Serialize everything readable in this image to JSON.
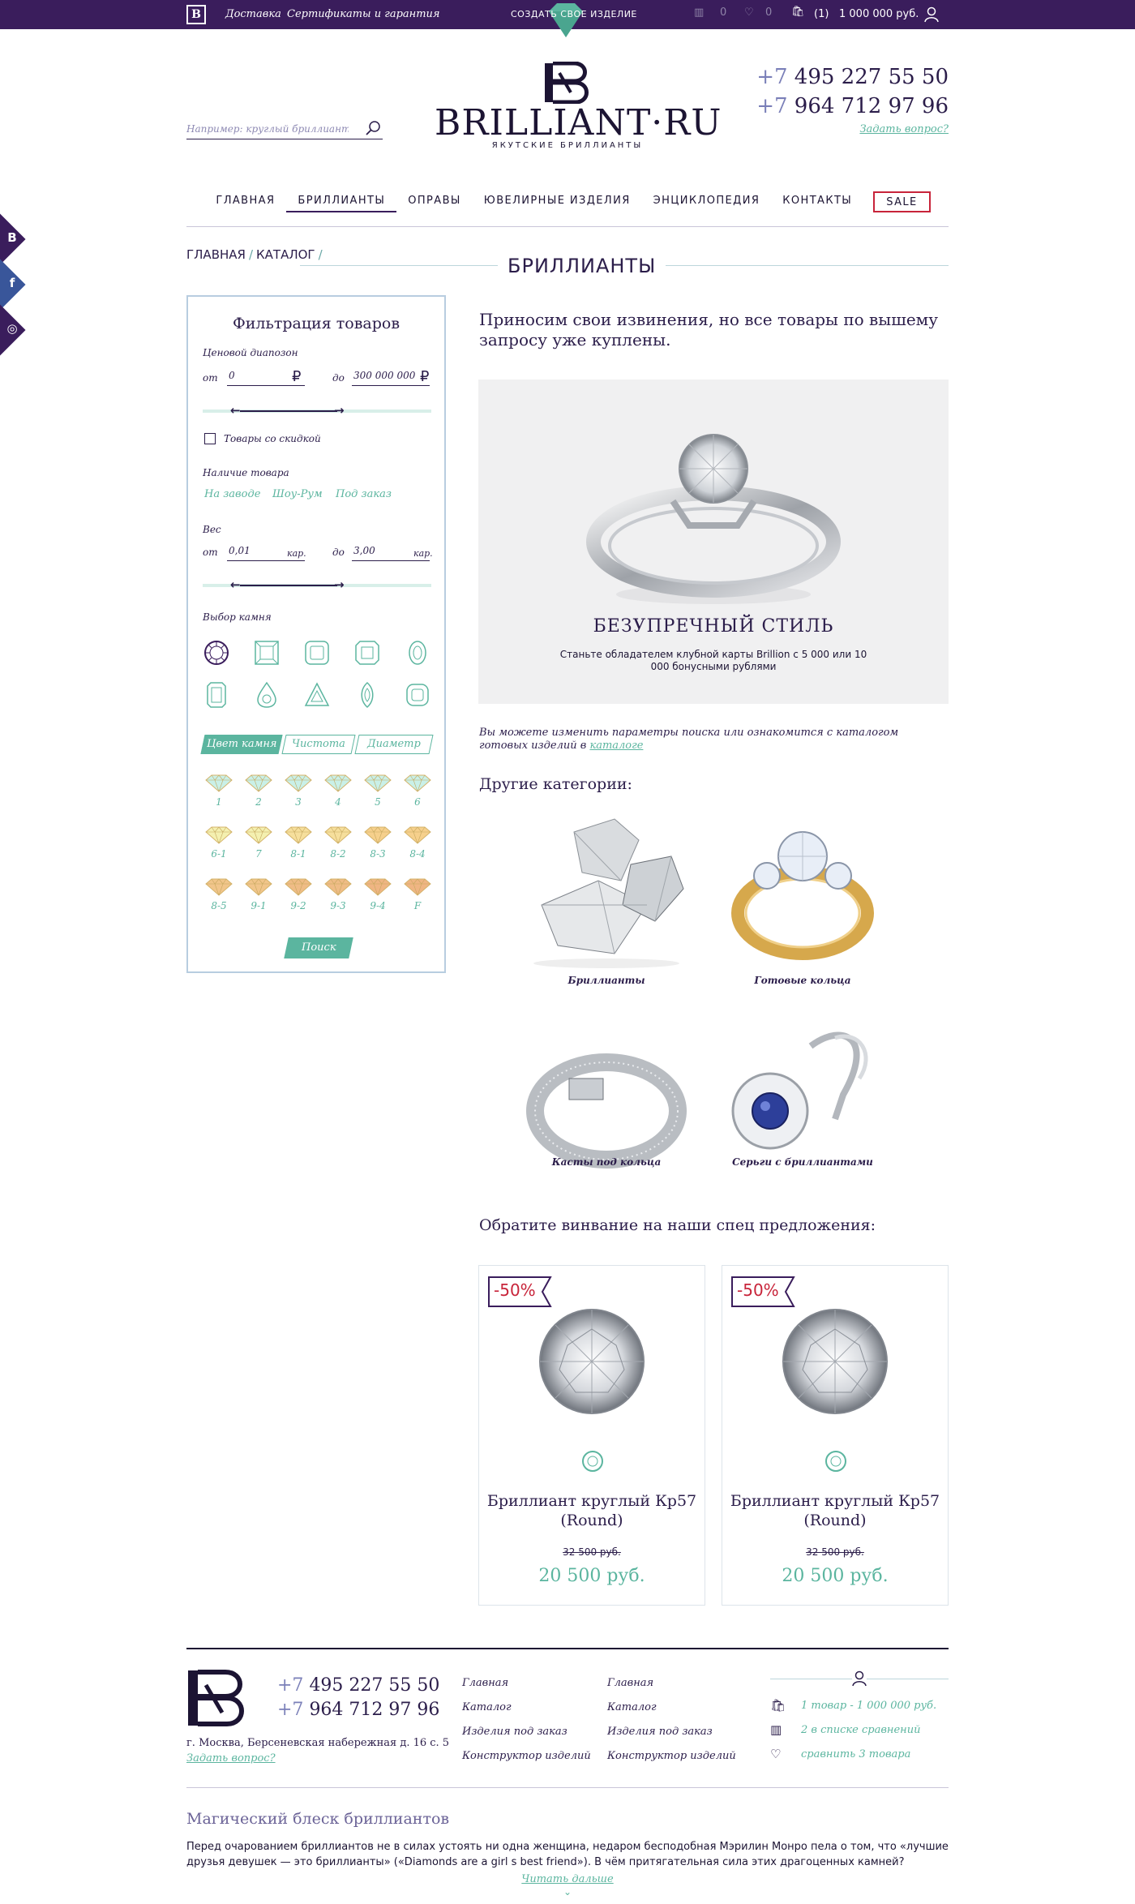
{
  "topbar": {
    "links": [
      "Доставка",
      "Сертификаты и гарантия"
    ],
    "create_label": "СОЗДАТЬ СВОЕ ИЗДЕЛИЕ",
    "compare_count": "0",
    "favorites_count": "0",
    "cart_count": "(1)",
    "cart_total": "1 000 000 руб."
  },
  "header": {
    "search_placeholder": "Например: круглый бриллиант",
    "brand_name": "BRILLIANT·RU",
    "brand_tagline": "ЯКУТСКИЕ БРИЛЛИАНТЫ",
    "phones": [
      {
        "prefix": "+7",
        "number": "495 227 55 50"
      },
      {
        "prefix": "+7",
        "number": "964 712 97 96"
      }
    ],
    "ask_question": "Задать вопрос?"
  },
  "nav": {
    "items": [
      "ГЛАВНАЯ",
      "БРИЛЛИАНТЫ",
      "ОПРАВЫ",
      "ЮВЕЛИРНЫЕ ИЗДЕЛИЯ",
      "ЭНЦИКЛОПЕДИЯ",
      "КОНТАКТЫ"
    ],
    "sale": "SALE"
  },
  "breadcrumbs": [
    "ГЛАВНАЯ",
    "КАТАЛОГ"
  ],
  "breadcrumb_sep": "/",
  "page_title": "БРИЛЛИАНТЫ",
  "social": [
    "B",
    "f",
    "◎"
  ],
  "filter": {
    "title": "Фильтрация товаров",
    "price_label": "Ценовой диапозон",
    "from": "от",
    "to": "до",
    "price_from": "0",
    "price_to": "300 000 000",
    "currency": "₽",
    "discount_label": "Товары со скидкой",
    "availability_label": "Наличие товара",
    "availability": [
      "На заводе",
      "Шоу-Рум",
      "Под заказ"
    ],
    "weight_label": "Вес",
    "weight_from": "0,01",
    "weight_to": "3,00",
    "weight_unit": "кар.",
    "stone_label": "Выбор камня",
    "tabs": [
      "Цвет камня",
      "Чистота",
      "Диаметр"
    ],
    "colors": [
      "1",
      "2",
      "3",
      "4",
      "5",
      "6",
      "6-1",
      "7",
      "8-1",
      "8-2",
      "8-3",
      "8-4",
      "8-5",
      "9-1",
      "9-2",
      "9-3",
      "9-4",
      "F"
    ],
    "search_button": "Поиск"
  },
  "content": {
    "apology": "Приносим свои извинения, но все товары по вышему запросу уже куплены.",
    "banner_title": "БЕЗУПРЕЧНЫЙ СТИЛЬ",
    "banner_text": "Станьте обладателем клубной карты Brillion с 5 000 или 10 000 бонусными рублями",
    "hint_text": "Вы можете изменить параметры поиска или ознакомится с каталогом готовых изделий в",
    "hint_link": "каталоге",
    "other_categories": "Другие категории:",
    "categories": [
      "Бриллианты",
      "Готовые кольца",
      "Касты под кольца",
      "Серьги с бриллиантами"
    ],
    "special_title": "Обратите винвание на наши спец предложения:",
    "products": [
      {
        "discount": "-50%",
        "title": "Бриллиант круглый Кр57 (Round)",
        "old_price": "32 500 руб.",
        "price": "20 500 руб."
      },
      {
        "discount": "-50%",
        "title": "Бриллиант круглый Кр57 (Round)",
        "old_price": "32 500 руб.",
        "price": "20 500 руб."
      }
    ]
  },
  "footer": {
    "phones": [
      {
        "prefix": "+7",
        "number": "495 227 55 50"
      },
      {
        "prefix": "+7",
        "number": "964 712 97 96"
      }
    ],
    "address": "г. Москва, Берсеневская набережная д. 16 с. 5",
    "ask_question": "Задать вопрос?",
    "links_col1": [
      "Главная",
      "Каталог",
      "Изделия под заказ",
      "Конструктор изделий"
    ],
    "links_col2": [
      "Главная",
      "Каталог",
      "Изделия под заказ",
      "Конструктор изделий"
    ],
    "stats": [
      "1 товар - 1 000 000 руб.",
      "2 в списке сравнений",
      "сравнить 3 товара"
    ],
    "magic_title": "Магический блеск бриллиантов",
    "magic_text": "Перед очарованием бриллиантов не в силах устоять ни одна женщина, недаром бесподобная Мэрилин Монро пела о том, что «лучшие друзья девушек — это бриллианты» («Diamonds are a girl s best friend»). В чём притягательная сила этих драгоценных камней?",
    "read_more": "Читать дальше"
  },
  "colors": {
    "primary": "#3a1d5c",
    "accent": "#5bb59f",
    "sale": "#c8243a"
  }
}
